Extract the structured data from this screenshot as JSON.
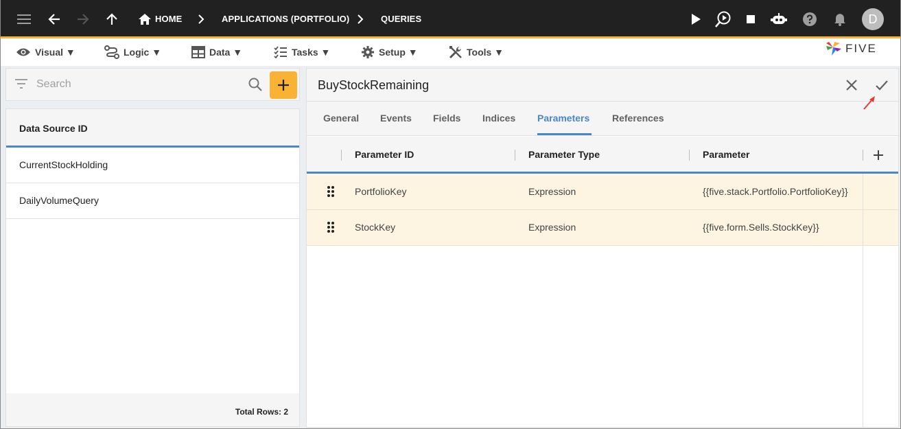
{
  "topbar": {
    "breadcrumb": {
      "home": "HOME",
      "app": "APPLICATIONS (PORTFOLIO)",
      "current": "QUERIES"
    },
    "avatar_letter": "D",
    "icons": [
      "menu-icon",
      "back-arrow-icon",
      "forward-arrow-icon",
      "up-arrow-icon",
      "home-icon",
      "play-icon",
      "debug-run-icon",
      "stop-icon",
      "chat-bot-icon",
      "help-icon",
      "bell-icon"
    ]
  },
  "menubar": {
    "visual": "Visual ▼",
    "logic": "Logic ▼",
    "data": "Data ▼",
    "tasks": "Tasks ▼",
    "setup": "Setup ▼",
    "tools": "Tools ▼",
    "logo": "FIVE"
  },
  "left_panel": {
    "search_placeholder": "Search",
    "column_header": "Data Source ID",
    "items": [
      {
        "label": "CurrentStockHolding"
      },
      {
        "label": "DailyVolumeQuery"
      }
    ],
    "footer": "Total Rows: 2"
  },
  "detail": {
    "title": "BuyStockRemaining",
    "tabs": [
      {
        "label": "General"
      },
      {
        "label": "Events"
      },
      {
        "label": "Fields"
      },
      {
        "label": "Indices"
      },
      {
        "label": "Parameters"
      },
      {
        "label": "References"
      }
    ],
    "active_tab": "Parameters",
    "grid": {
      "columns": [
        "Parameter ID",
        "Parameter Type",
        "Parameter"
      ],
      "rows": [
        {
          "id": "PortfolioKey",
          "type": "Expression",
          "parameter": "{{five.stack.Portfolio.PortfolioKey}}"
        },
        {
          "id": "StockKey",
          "type": "Expression",
          "parameter": "{{five.form.Sells.StockKey}}"
        }
      ]
    }
  },
  "colors": {
    "topbar_bg": "#212121",
    "accent_yellow": "#f9b233",
    "active_blue": "#4a86c8",
    "row_highlight": "#fdf4e1",
    "annotation_red": "#e53935"
  }
}
